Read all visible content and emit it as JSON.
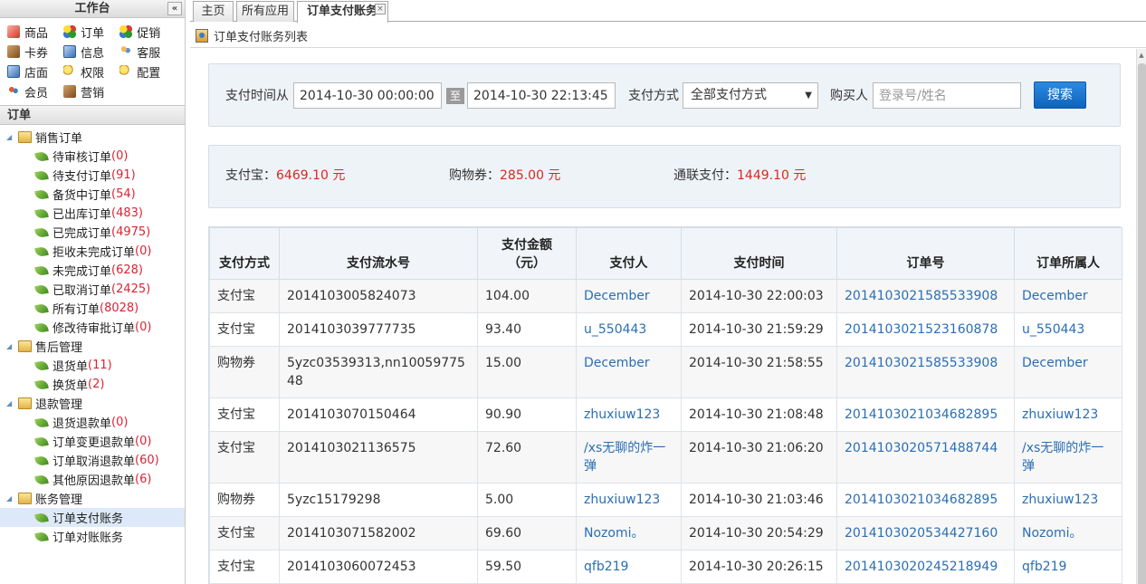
{
  "sidebar": {
    "title": "工作台",
    "collapse_label": "«",
    "quick": [
      {
        "label": "商品",
        "icon": "goods-icon"
      },
      {
        "label": "订单",
        "icon": "order-icon"
      },
      {
        "label": "促销",
        "icon": "promo-icon"
      },
      {
        "label": "卡券",
        "icon": "coupon-icon"
      },
      {
        "label": "信息",
        "icon": "info-icon"
      },
      {
        "label": "客服",
        "icon": "service-icon"
      },
      {
        "label": "店面",
        "icon": "store-icon"
      },
      {
        "label": "权限",
        "icon": "key-icon"
      },
      {
        "label": "配置",
        "icon": "config-icon"
      },
      {
        "label": "会员",
        "icon": "member-icon"
      },
      {
        "label": "营销",
        "icon": "marketing-icon"
      }
    ],
    "section": "订单",
    "tree": [
      {
        "folder": "销售订单",
        "items": [
          {
            "label": "待审核订单",
            "count": "(0)"
          },
          {
            "label": "待支付订单",
            "count": "(91)"
          },
          {
            "label": "备货中订单",
            "count": "(54)"
          },
          {
            "label": "已出库订单",
            "count": "(483)"
          },
          {
            "label": "已完成订单",
            "count": "(4975)"
          },
          {
            "label": "拒收未完成订单",
            "count": "(0)"
          },
          {
            "label": "未完成订单",
            "count": "(628)"
          },
          {
            "label": "已取消订单",
            "count": "(2425)"
          },
          {
            "label": "所有订单",
            "count": "(8028)"
          },
          {
            "label": "修改待审批订单",
            "count": "(0)"
          }
        ]
      },
      {
        "folder": "售后管理",
        "items": [
          {
            "label": "退货单",
            "count": "(11)"
          },
          {
            "label": "换货单",
            "count": "(2)"
          }
        ]
      },
      {
        "folder": "退款管理",
        "items": [
          {
            "label": "退货退款单",
            "count": "(0)"
          },
          {
            "label": "订单变更退款单",
            "count": "(0)"
          },
          {
            "label": "订单取消退款单",
            "count": "(60)"
          },
          {
            "label": "其他原因退款单",
            "count": "(6)"
          }
        ]
      },
      {
        "folder": "账务管理",
        "items": [
          {
            "label": "订单支付账务",
            "count": ""
          },
          {
            "label": "订单对账账务",
            "count": ""
          }
        ]
      }
    ]
  },
  "tabs": [
    {
      "label": "主页"
    },
    {
      "label": "所有应用"
    },
    {
      "label": "订单支付账务",
      "close": "×"
    }
  ],
  "page_title": "订单支付账务列表",
  "filter": {
    "time_label": "支付时间从",
    "start": "2014-10-30 00:00:00",
    "to_label": "至",
    "end": "2014-10-30 22:13:45",
    "method_label": "支付方式",
    "method_value": "全部支付方式",
    "buyer_label": "购买人",
    "buyer_placeholder": "登录号/姓名",
    "search_label": "搜索"
  },
  "summary": {
    "alipay_label": "支付宝：",
    "alipay_value": "6469.10 元",
    "voucher_label": "购物券：",
    "voucher_value": "285.00 元",
    "unionpay_label": "通联支付：",
    "unionpay_value": "1449.10 元"
  },
  "table": {
    "headers": [
      "支付方式",
      "支付流水号",
      "支付金额\n（元）",
      "支付人",
      "支付时间",
      "订单号",
      "订单所属人"
    ],
    "header_amount_line1": "支付金额",
    "header_amount_line2": "（元）",
    "rows": [
      [
        "支付宝",
        "2014103005824073",
        "104.00",
        "December",
        "2014-10-30 22:00:03",
        "2014103021585533908",
        "December"
      ],
      [
        "支付宝",
        "2014103039777735",
        "93.40",
        "u_550443",
        "2014-10-30 21:59:29",
        "2014103021523160878",
        "u_550443"
      ],
      [
        "购物券",
        "5yzc03539313,nn1005977548",
        "15.00",
        "December",
        "2014-10-30 21:58:55",
        "2014103021585533908",
        "December"
      ],
      [
        "支付宝",
        "2014103070150464",
        "90.90",
        "zhuxiuw123",
        "2014-10-30 21:08:48",
        "2014103021034682895",
        "zhuxiuw123"
      ],
      [
        "支付宝",
        "2014103021136575",
        "72.60",
        "/xs无聊的炸一弹",
        "2014-10-30 21:06:20",
        "2014103020571488744",
        "/xs无聊的炸一弹"
      ],
      [
        "购物券",
        "5yzc15179298",
        "5.00",
        "zhuxiuw123",
        "2014-10-30 21:03:46",
        "2014103021034682895",
        "zhuxiuw123"
      ],
      [
        "支付宝",
        "2014103071582002",
        "69.60",
        "Nozomi。",
        "2014-10-30 20:54:29",
        "2014103020534427160",
        "Nozomi。"
      ],
      [
        "支付宝",
        "2014103060072453",
        "59.50",
        "qfb219",
        "2014-10-30 20:26:15",
        "2014103020245218949",
        "qfb219"
      ]
    ]
  }
}
